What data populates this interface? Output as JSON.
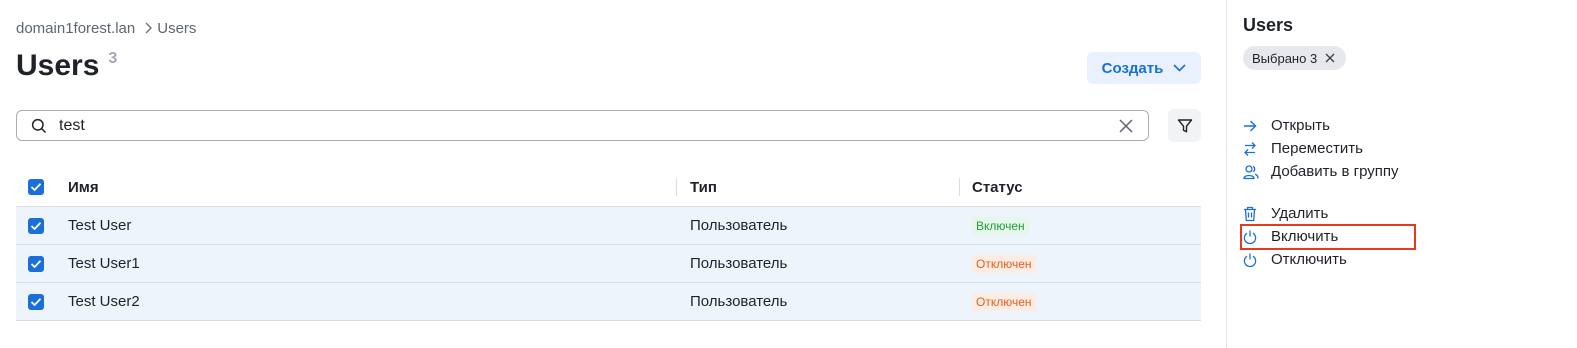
{
  "breadcrumb": {
    "domain": "domain1forest.lan",
    "current": "Users"
  },
  "page": {
    "title": "Users",
    "count": "3"
  },
  "create_button": {
    "label": "Создать"
  },
  "search": {
    "value": "test"
  },
  "table": {
    "columns": {
      "name": "Имя",
      "type": "Тип",
      "status": "Статус"
    },
    "rows": [
      {
        "name": "Test User",
        "type": "Пользователь",
        "status": "Включен",
        "status_kind": "enabled"
      },
      {
        "name": "Test User1",
        "type": "Пользователь",
        "status": "Отключен",
        "status_kind": "disabled"
      },
      {
        "name": "Test User2",
        "type": "Пользователь",
        "status": "Отключен",
        "status_kind": "disabled"
      }
    ]
  },
  "side_panel": {
    "title": "Users",
    "selection_chip": "Выбрано 3",
    "actions": [
      {
        "label": "Открыть",
        "icon": "arrow-right-icon"
      },
      {
        "label": "Переместить",
        "icon": "swap-arrows-icon"
      },
      {
        "label": "Добавить в группу",
        "icon": "users-group-icon"
      },
      {
        "label": "Удалить",
        "icon": "trash-icon"
      },
      {
        "label": "Включить",
        "icon": "power-icon"
      },
      {
        "label": "Отключить",
        "icon": "power-icon"
      }
    ]
  },
  "colors": {
    "accent": "#1a6fd9",
    "enabled": "#1f9d3a",
    "disabled": "#e2601f",
    "highlight": "#e23b1e",
    "row_selected_bg": "#eef4fc"
  }
}
